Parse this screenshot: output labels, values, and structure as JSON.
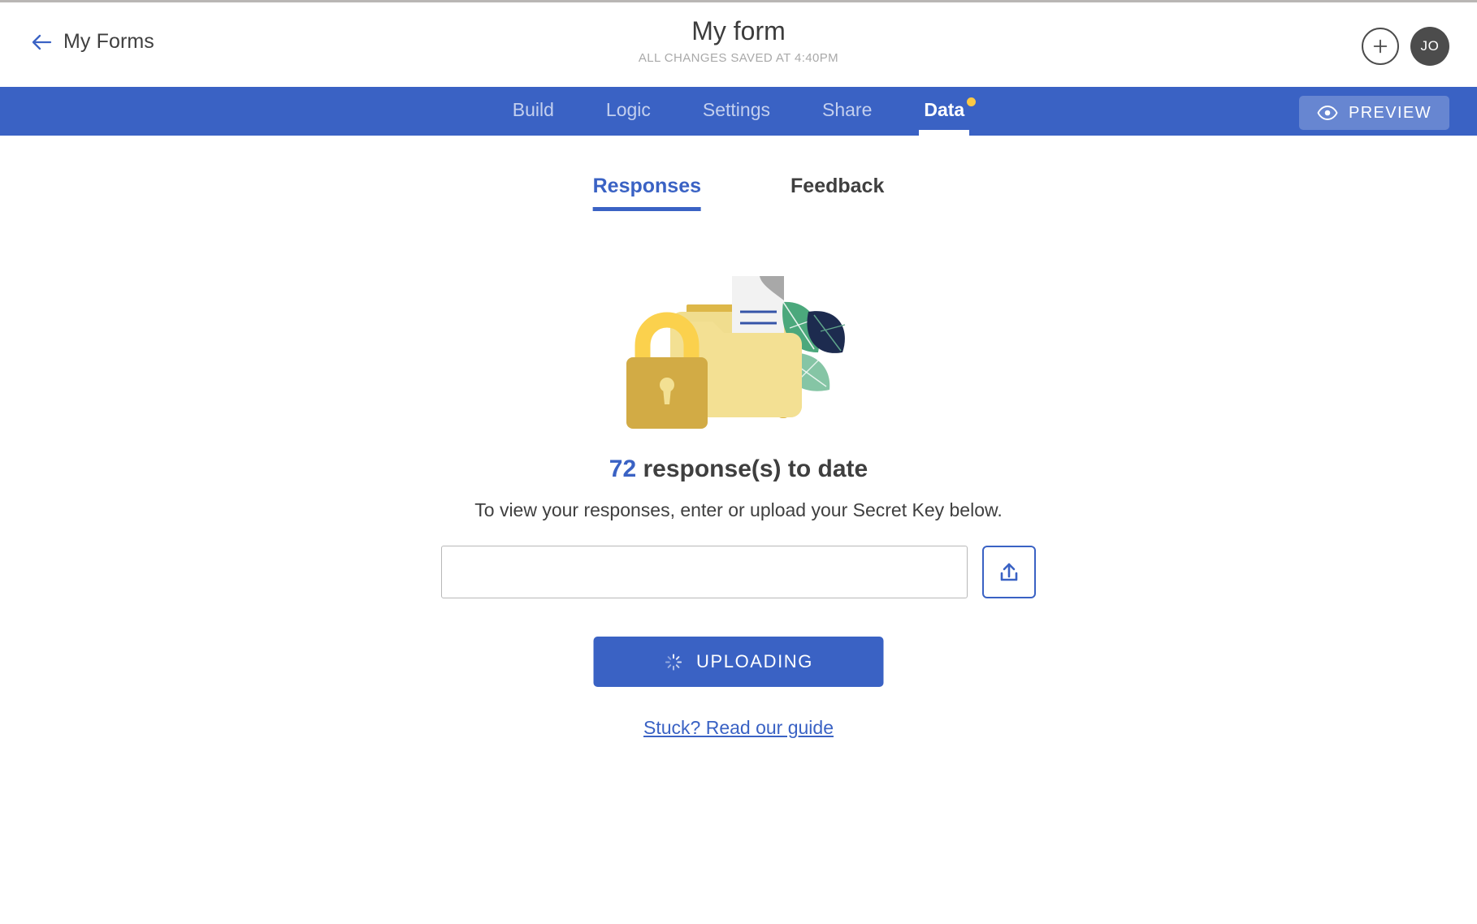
{
  "header": {
    "back_label": "My Forms",
    "back_icon": "arrow-left-icon",
    "title": "My form",
    "saved_status": "ALL CHANGES SAVED AT 4:40PM",
    "add_icon": "plus-icon",
    "avatar_initials": "JO"
  },
  "nav": {
    "tabs": [
      {
        "label": "Build",
        "active": false,
        "dot": false
      },
      {
        "label": "Logic",
        "active": false,
        "dot": false
      },
      {
        "label": "Settings",
        "active": false,
        "dot": false
      },
      {
        "label": "Share",
        "active": false,
        "dot": false
      },
      {
        "label": "Data",
        "active": true,
        "dot": true
      }
    ],
    "preview_label": "PREVIEW",
    "preview_icon": "eye-icon",
    "bar_color": "#3a62c4",
    "dot_color": "#fbc945"
  },
  "content": {
    "sub_tabs": [
      {
        "label": "Responses",
        "active": true
      },
      {
        "label": "Feedback",
        "active": false
      }
    ],
    "illustration": "locked-folder-illustration",
    "response_count": "72",
    "response_count_suffix": " response(s) to date",
    "instruction": "To view your responses, enter or upload your Secret Key below.",
    "secret_key_value": "",
    "secret_key_placeholder": "",
    "upload_icon": "upload-icon",
    "uploading_label": "UPLOADING",
    "uploading_icon": "spinner-icon",
    "guide_link_label": "Stuck? Read our guide",
    "accent_color": "#3a62c4",
    "link_color": "#3a62c4"
  }
}
